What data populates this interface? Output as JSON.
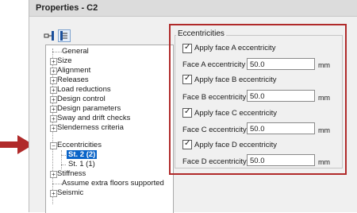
{
  "window": {
    "title": "Properties - C2"
  },
  "toolbar": {
    "icons": [
      "collapse-icon",
      "expand-icon"
    ]
  },
  "tree": {
    "items": [
      {
        "label": "General",
        "expander": false
      },
      {
        "label": "Size",
        "expander": true
      },
      {
        "label": "Alignment",
        "expander": true
      },
      {
        "label": "Releases",
        "expander": true
      },
      {
        "label": "Load reductions",
        "expander": true
      },
      {
        "label": "Design control",
        "expander": true
      },
      {
        "label": "Design parameters",
        "expander": true
      },
      {
        "label": "Sway and drift checks",
        "expander": true
      },
      {
        "label": "Slenderness criteria",
        "expander": true
      },
      {
        "label": "Eccentricities",
        "expander": true,
        "expanded": true
      },
      {
        "label": "St. 2 (2)",
        "child": true,
        "selected": true
      },
      {
        "label": "St. 1 (1)",
        "child": true
      },
      {
        "label": "Stiffness",
        "expander": true
      },
      {
        "label": "Assume extra floors supported",
        "expander": false
      },
      {
        "label": "Seismic",
        "expander": true
      }
    ],
    "expand_symbol": "+",
    "collapse_symbol": "−"
  },
  "eccentricities": {
    "group_title": "Eccentricities",
    "faces": [
      {
        "checkbox_label": "Apply face A eccentricity",
        "checked": true,
        "field_label": "Face A eccentricity",
        "value": "50.0",
        "unit": "mm"
      },
      {
        "checkbox_label": "Apply face B eccentricity",
        "checked": true,
        "field_label": "Face B eccentricity",
        "value": "50.0",
        "unit": "mm"
      },
      {
        "checkbox_label": "Apply face C eccentricity",
        "checked": true,
        "field_label": "Face C eccentricity",
        "value": "50.0",
        "unit": "mm"
      },
      {
        "checkbox_label": "Apply face D eccentricity",
        "checked": true,
        "field_label": "Face D eccentricity",
        "value": "50.0",
        "unit": "mm"
      }
    ]
  },
  "annotation": {
    "arrow_color": "#b02a2a",
    "highlight_color": "#b02a2a",
    "selection_color": "#0a64c8"
  }
}
